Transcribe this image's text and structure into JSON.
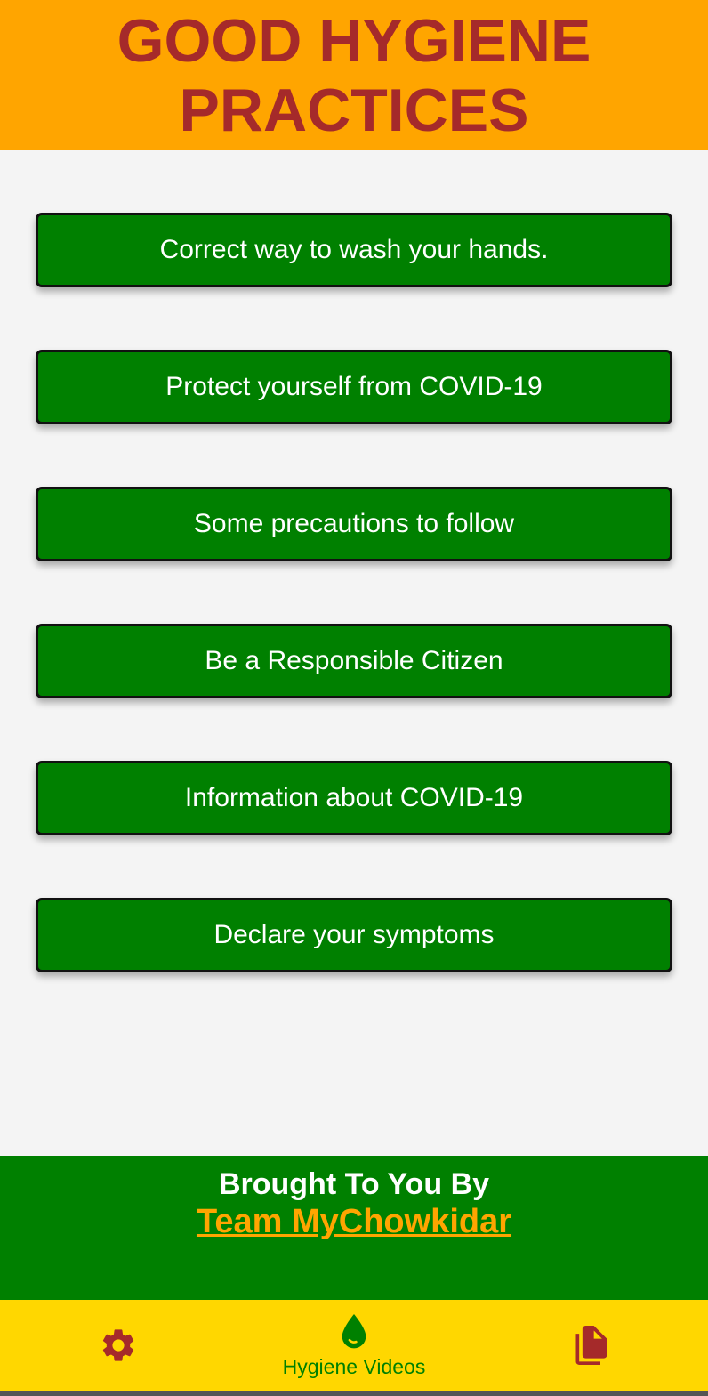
{
  "header": {
    "title": "GOOD HYGIENE PRACTICES"
  },
  "menu": {
    "items": [
      {
        "label": "Correct way to wash your hands."
      },
      {
        "label": "Protect yourself from COVID-19"
      },
      {
        "label": "Some precautions to follow"
      },
      {
        "label": "Be a Responsible Citizen"
      },
      {
        "label": "Information about COVID-19"
      },
      {
        "label": "Declare your symptoms"
      }
    ]
  },
  "credit": {
    "brought_by": "Brought To You By",
    "team": "Team MyChowkidar "
  },
  "bottom_nav": {
    "items": [
      {
        "icon": "gear-icon",
        "label": ""
      },
      {
        "icon": "water-drop-icon",
        "label": "Hygiene Videos"
      },
      {
        "icon": "documents-icon",
        "label": ""
      }
    ]
  },
  "colors": {
    "header_bg": "#ffa500",
    "title_text": "#a52a2a",
    "button_bg": "#008000",
    "credit_bg": "#008000",
    "team_link": "#ffa500",
    "nav_bg": "#ffd700",
    "nav_active": "#008000",
    "nav_inactive": "#a52a2a"
  }
}
